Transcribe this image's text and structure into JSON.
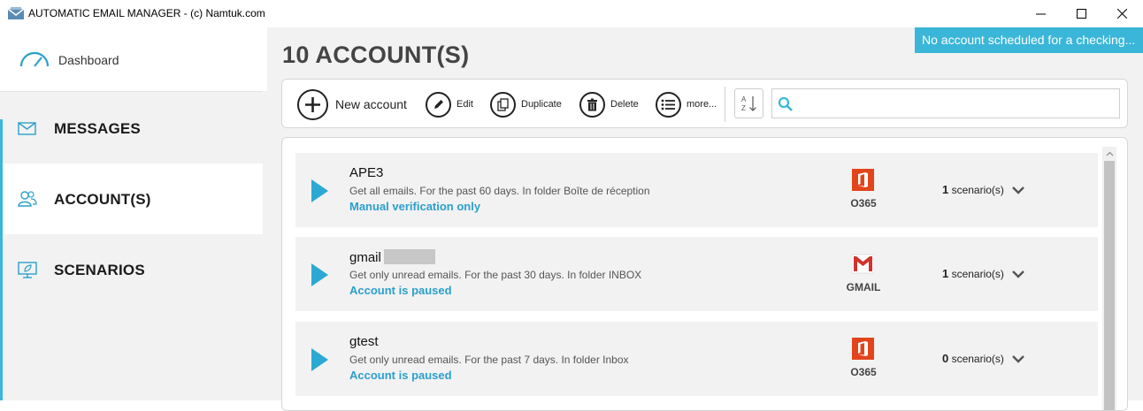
{
  "window": {
    "title": "AUTOMATIC EMAIL MANAGER - (c) Namtuk.com"
  },
  "sidebar": {
    "dashboard_label": "Dashboard",
    "items": [
      {
        "label": "MESSAGES",
        "icon": "envelope-icon"
      },
      {
        "label": "ACCOUNT(S)",
        "icon": "users-icon"
      },
      {
        "label": "SCENARIOS",
        "icon": "monitor-leaf-icon"
      }
    ],
    "active_item": "ACCOUNT(S)",
    "accent_color": "#3ab6d9"
  },
  "main": {
    "title": "10 ACCOUNT(S)",
    "notice": "No account scheduled for a checking..."
  },
  "toolbar": {
    "new_label": "New account",
    "edit_label": "Edit",
    "duplicate_label": "Duplicate",
    "delete_label": "Delete",
    "more_label": "more...",
    "sort_icon": "sort-az-icon",
    "search_placeholder": "",
    "search_value": ""
  },
  "accounts": [
    {
      "name": "APE3",
      "redacted": false,
      "description": "Get all emails. For the past 60 days. In folder Boîte de réception",
      "status": "Manual verification only",
      "provider": "O365",
      "scenarios_count": "1",
      "scenarios_label": "scenario(s)"
    },
    {
      "name": "gmail",
      "redacted": true,
      "description": "Get only unread emails. For the past 30 days. In folder INBOX",
      "status": "Account is paused",
      "provider": "GMAIL",
      "scenarios_count": "1",
      "scenarios_label": "scenario(s)"
    },
    {
      "name": "gtest",
      "redacted": false,
      "description": "Get only unread emails. For the past 7 days. In folder Inbox",
      "status": "Account is paused",
      "provider": "O365",
      "scenarios_count": "0",
      "scenarios_label": "scenario(s)"
    }
  ],
  "colors": {
    "accent": "#3ab6d9",
    "play": "#2ba9d3",
    "o365": "#e2441c",
    "gmail": "#d0342c"
  }
}
